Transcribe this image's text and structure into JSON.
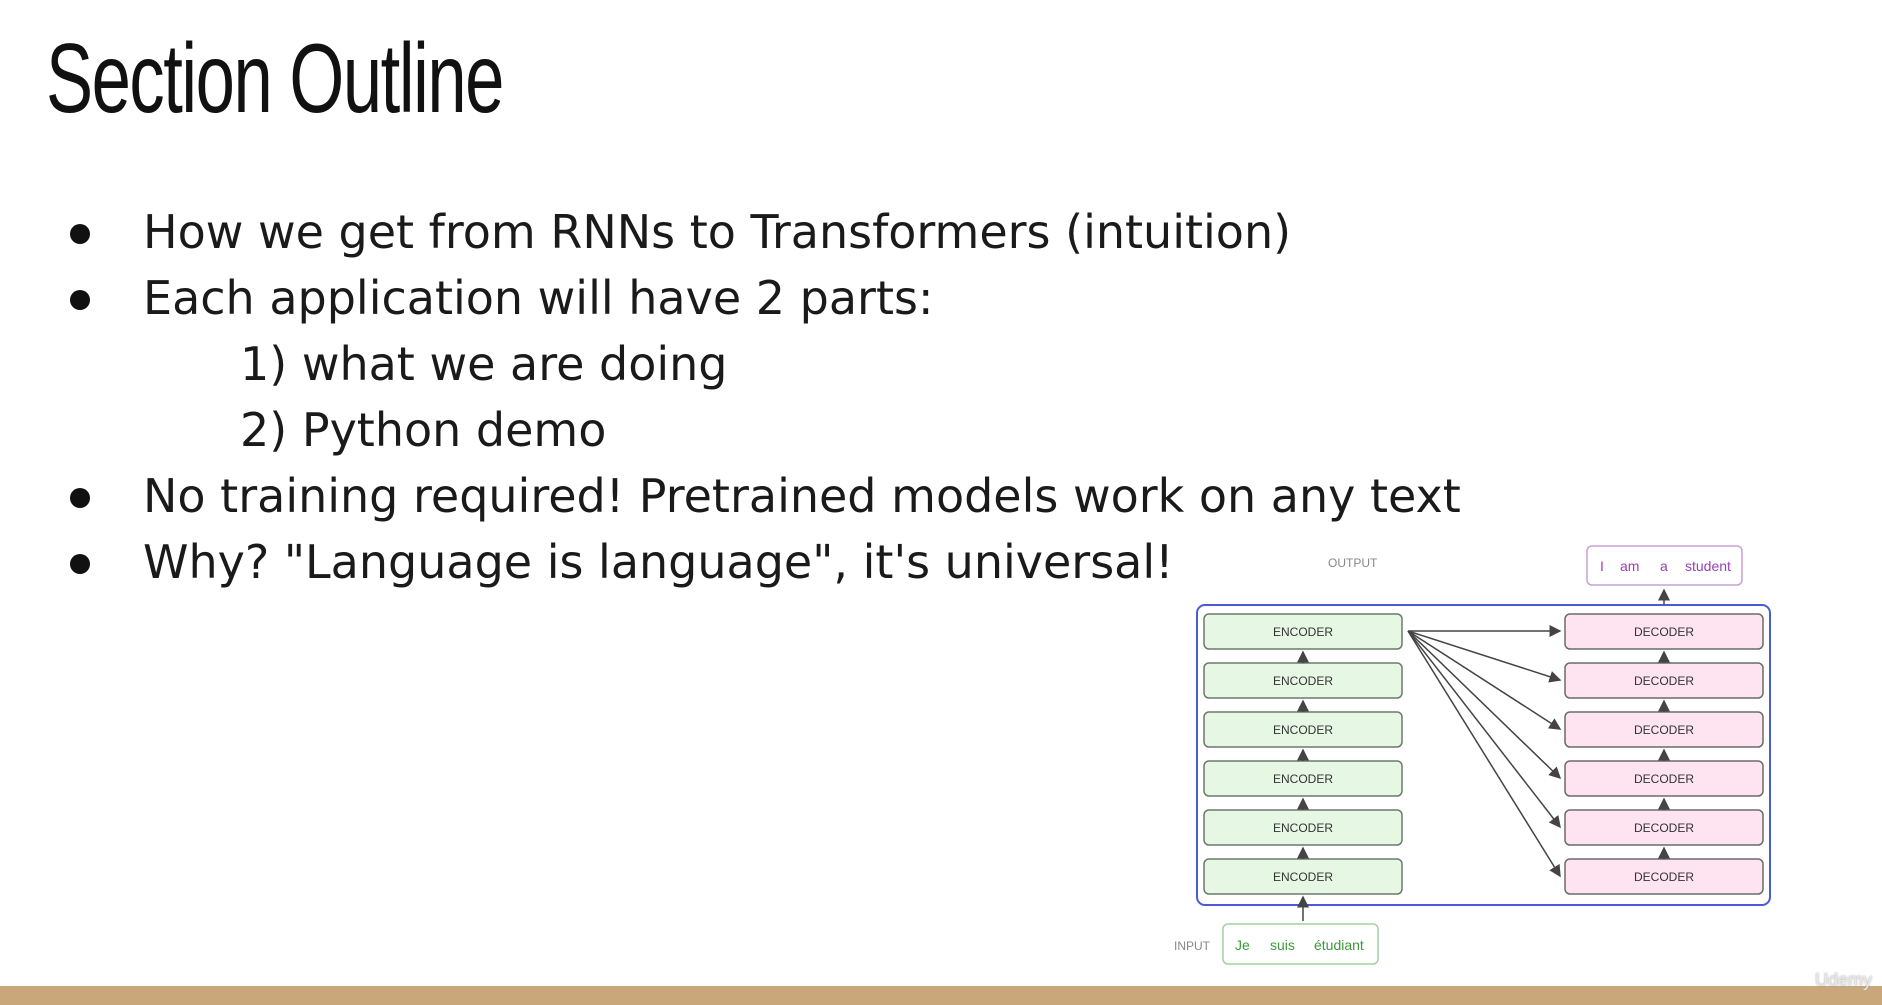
{
  "slide": {
    "title": "Section Outline",
    "bullets": [
      {
        "text": "How we get from RNNs to Transformers (intuition)"
      },
      {
        "text": "Each application will have 2 parts:"
      },
      {
        "text": "No training required! Pretrained models work on any text"
      },
      {
        "text": "Why? \"Language is language\", it's universal!"
      }
    ],
    "sub_items": [
      "1) what we are doing",
      "2) Python demo"
    ]
  },
  "diagram": {
    "output_label": "OUTPUT",
    "output_tokens": [
      "I",
      "am",
      "a",
      "student"
    ],
    "input_label": "INPUT",
    "input_tokens": [
      "Je",
      "suis",
      "étudiant"
    ],
    "encoder_label": "ENCODER",
    "decoder_label": "DECODER",
    "colors": {
      "encoder_fill": "#e6f7e4",
      "decoder_fill": "#fde4f0",
      "frame": "#4a5bd4",
      "output_text": "#9b3fb3",
      "input_text": "#3c9a3c"
    }
  },
  "footer": {
    "watermark": "Udemy",
    "bar_color": "#c9a77a"
  }
}
